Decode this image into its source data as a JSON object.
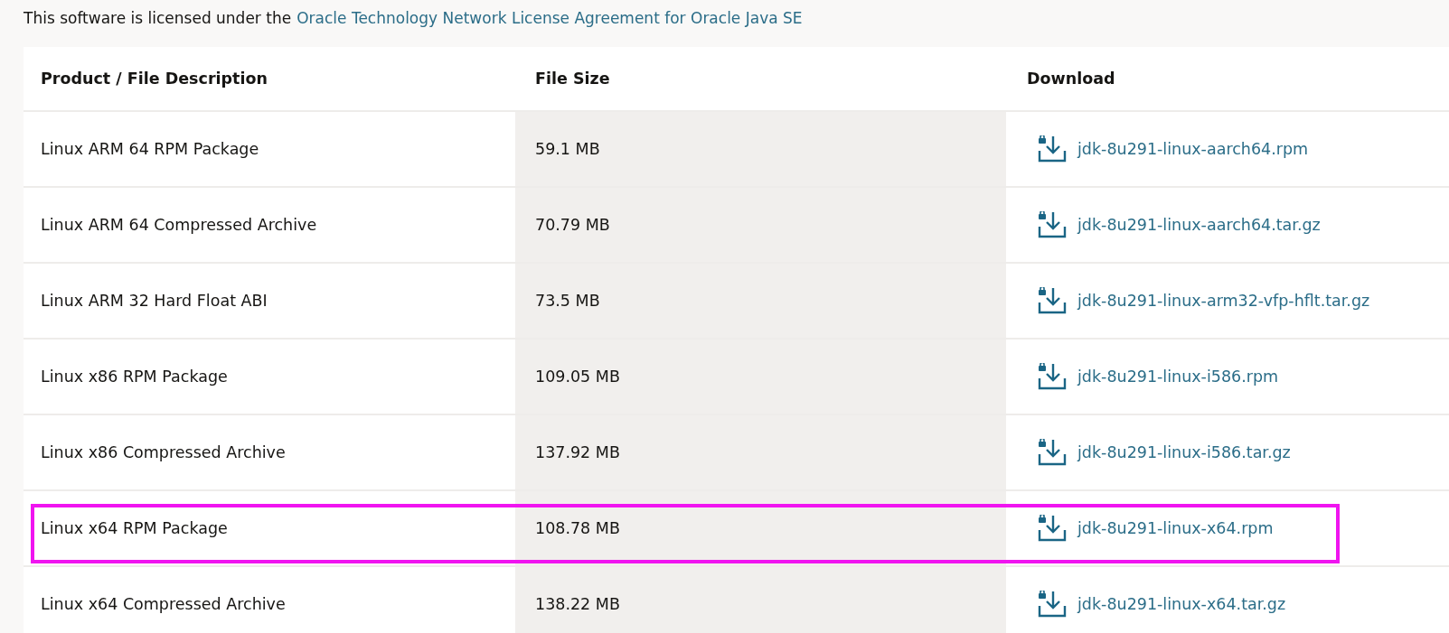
{
  "license": {
    "text": "This software is licensed under the",
    "link": "Oracle Technology Network License Agreement for Oracle Java SE"
  },
  "table": {
    "columns": [
      "Product / File Description",
      "File Size",
      "Download"
    ],
    "rows": [
      {
        "description": "Linux ARM 64 RPM Package",
        "size": "59.1 MB",
        "file": "jdk-8u291-linux-aarch64.rpm",
        "highlighted": false
      },
      {
        "description": "Linux ARM 64 Compressed Archive",
        "size": "70.79 MB",
        "file": "jdk-8u291-linux-aarch64.tar.gz",
        "highlighted": false
      },
      {
        "description": "Linux ARM 32 Hard Float ABI",
        "size": "73.5 MB",
        "file": "jdk-8u291-linux-arm32-vfp-hflt.tar.gz",
        "highlighted": false
      },
      {
        "description": "Linux x86 RPM Package",
        "size": "109.05 MB",
        "file": "jdk-8u291-linux-i586.rpm",
        "highlighted": false
      },
      {
        "description": "Linux x86 Compressed Archive",
        "size": "137.92 MB",
        "file": "jdk-8u291-linux-i586.tar.gz",
        "highlighted": false
      },
      {
        "description": "Linux x64 RPM Package",
        "size": "108.78 MB",
        "file": "jdk-8u291-linux-x64.rpm",
        "highlighted": true
      },
      {
        "description": "Linux x64 Compressed Archive",
        "size": "138.22 MB",
        "file": "jdk-8u291-linux-x64.tar.gz",
        "highlighted": false
      }
    ]
  }
}
